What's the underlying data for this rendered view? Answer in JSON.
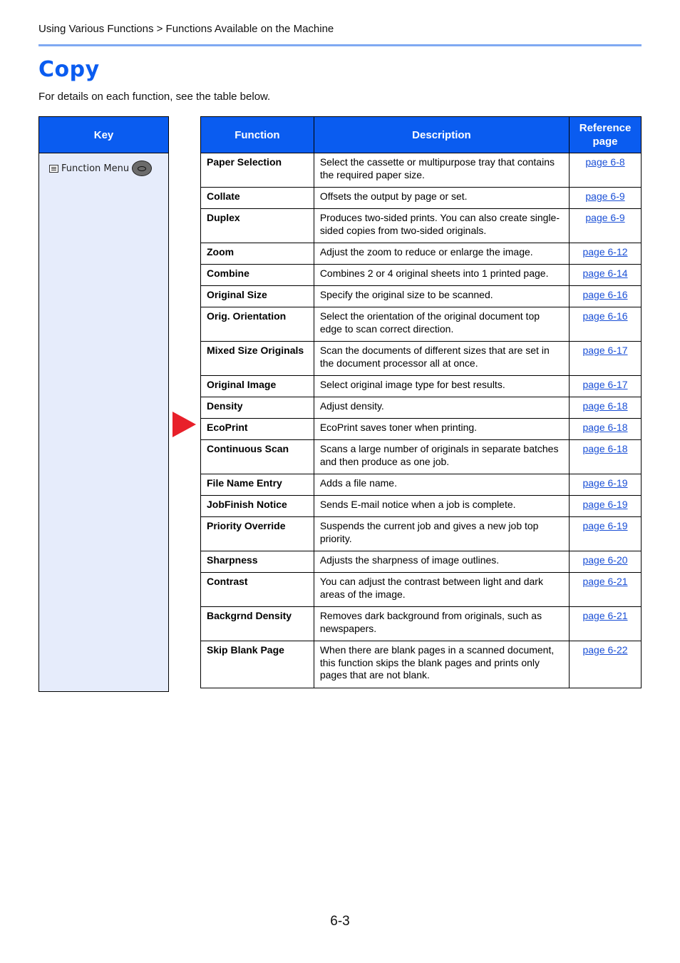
{
  "header": {
    "breadcrumb": "Using Various Functions > Functions Available on the Machine",
    "accent_color": "#7fa9f2"
  },
  "title": "Copy",
  "intro": "For details on each function, see the table below.",
  "key": {
    "header": "Key",
    "item_label": "Function Menu",
    "item_icon": "list-menu-icon",
    "button_icon": "function-menu-key-icon"
  },
  "indicator": {
    "icon": "red-triangle-arrow-icon",
    "color": "#e8202a"
  },
  "table": {
    "headers": {
      "function": "Function",
      "description": "Description",
      "reference": "Reference page"
    },
    "rows": [
      {
        "function": "Paper Selection",
        "description": "Select the cassette or multipurpose tray that contains the required paper size.",
        "ref": "page 6-8"
      },
      {
        "function": "Collate",
        "description": "Offsets the output by page or set.",
        "ref": "page 6-9"
      },
      {
        "function": "Duplex",
        "description": "Produces two-sided prints. You can also create single-sided copies from two-sided originals.",
        "ref": "page 6-9"
      },
      {
        "function": "Zoom",
        "description": "Adjust the zoom to reduce or enlarge the image.",
        "ref": "page 6-12"
      },
      {
        "function": "Combine",
        "description": "Combines 2 or 4 original sheets into 1 printed page.",
        "ref": "page 6-14"
      },
      {
        "function": "Original Size",
        "description": "Specify the original size to be scanned.",
        "ref": "page 6-16"
      },
      {
        "function": "Orig. Orientation",
        "description": "Select the orientation of the original document top edge to scan correct direction.",
        "ref": "page 6-16"
      },
      {
        "function": "Mixed Size Originals",
        "description": "Scan the documents of different sizes that are set in the document processor all at once.",
        "ref": "page 6-17"
      },
      {
        "function": "Original Image",
        "description": "Select original image type for best results.",
        "ref": "page 6-17"
      },
      {
        "function": "Density",
        "description": "Adjust density.",
        "ref": "page 6-18"
      },
      {
        "function": "EcoPrint",
        "description": "EcoPrint saves toner when printing.",
        "ref": "page 6-18"
      },
      {
        "function": "Continuous Scan",
        "description": "Scans a large number of originals in separate batches and then produce as one job.",
        "ref": "page 6-18"
      },
      {
        "function": "File Name Entry",
        "description": "Adds a file name.",
        "ref": "page 6-19"
      },
      {
        "function": "JobFinish Notice",
        "description": "Sends E-mail notice when a job is complete.",
        "ref": "page 6-19"
      },
      {
        "function": "Priority Override",
        "description": "Suspends the current job and gives a new job top priority.",
        "ref": "page 6-19"
      },
      {
        "function": "Sharpness",
        "description": "Adjusts the sharpness of image outlines.",
        "ref": "page 6-20"
      },
      {
        "function": "Contrast",
        "description": "You can adjust the contrast between light and dark areas of the image.",
        "ref": "page 6-21"
      },
      {
        "function": "Backgrnd Density",
        "description": "Removes dark background from originals, such as newspapers.",
        "ref": "page 6-21"
      },
      {
        "function": "Skip Blank Page",
        "description": "When there are blank pages in a scanned document, this function skips the blank pages and prints only pages that are not blank.",
        "ref": "page 6-22"
      }
    ]
  },
  "footer": {
    "page_number": "6-3"
  },
  "colors": {
    "header_blue": "#0a5cf0",
    "key_bg": "#e6ecfb",
    "link": "#1a4fd6"
  }
}
